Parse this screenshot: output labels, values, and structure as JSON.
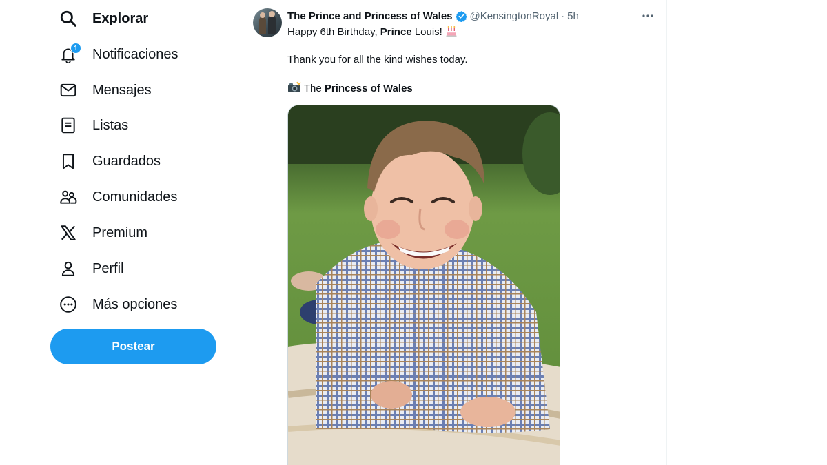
{
  "nav": {
    "items": [
      {
        "label": "Explorar",
        "icon": "search-icon"
      },
      {
        "label": "Notificaciones",
        "icon": "bell-icon",
        "badge": "1"
      },
      {
        "label": "Mensajes",
        "icon": "envelope-icon"
      },
      {
        "label": "Listas",
        "icon": "list-icon"
      },
      {
        "label": "Guardados",
        "icon": "bookmark-icon"
      },
      {
        "label": "Comunidades",
        "icon": "communities-icon"
      },
      {
        "label": "Premium",
        "icon": "x-logo-icon"
      },
      {
        "label": "Perfil",
        "icon": "person-icon"
      },
      {
        "label": "Más opciones",
        "icon": "more-circle-icon"
      }
    ],
    "post_button": "Postear"
  },
  "tweet": {
    "author": "The Prince and Princess of Wales",
    "handle": "@KensingtonRoyal",
    "separator": "·",
    "time": "5h",
    "line1": {
      "pre": "Happy 6th Birthday, ",
      "bold": "Prince",
      "post": " Louis! ",
      "emoji": "🎂"
    },
    "line2": "Thank you for all the kind wishes today.",
    "line3": {
      "emoji": "📸",
      "pre": " The ",
      "bold": "Princess of Wales"
    },
    "media_alt": "Photo of Prince Louis smiling, lying on a blanket on the grass"
  },
  "colors": {
    "accent": "#1d9bf0",
    "text": "#0f1419",
    "secondary": "#536471",
    "border": "#eff3f4"
  }
}
